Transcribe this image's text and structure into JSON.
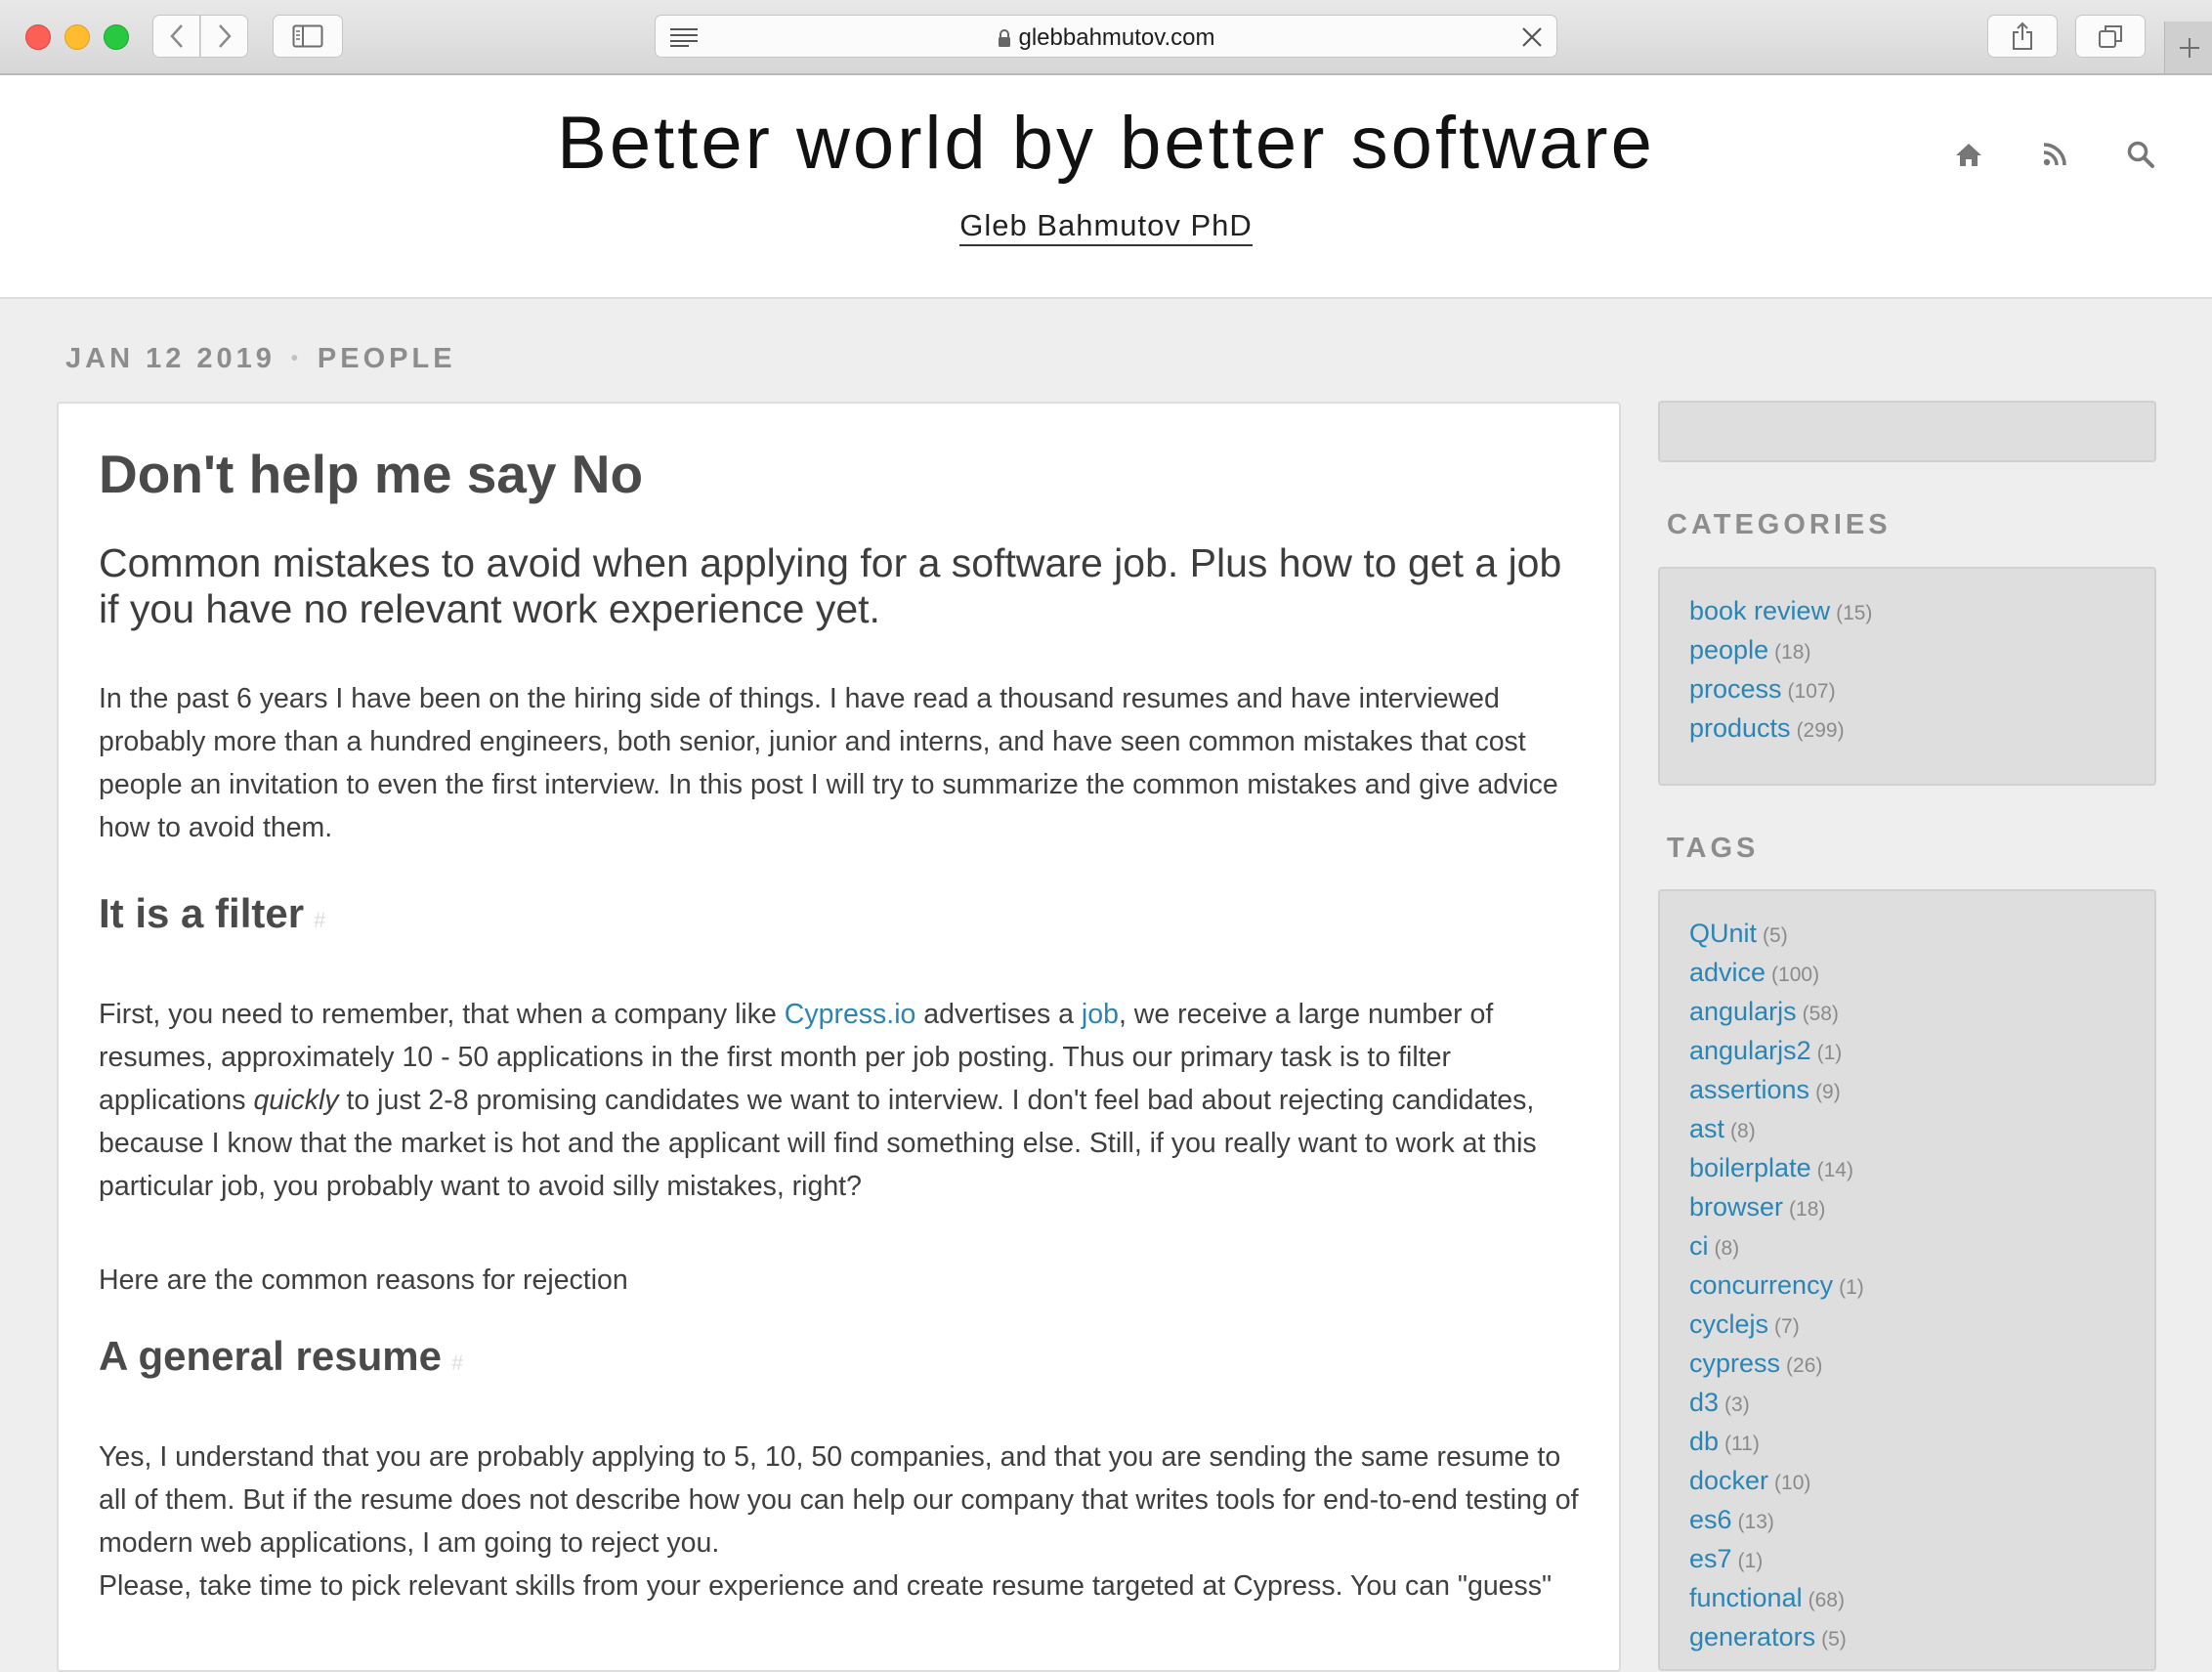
{
  "browser": {
    "url": "glebbahmutov.com",
    "icons": [
      "back-icon",
      "forward-icon",
      "sidebar-icon",
      "reader-icon",
      "lock-icon",
      "close-icon",
      "share-icon",
      "tabs-icon",
      "plus-icon"
    ]
  },
  "header": {
    "title": "Better world by better software",
    "subtitle": "Gleb Bahmutov PhD",
    "icons": [
      "home-icon",
      "rss-icon",
      "search-icon"
    ]
  },
  "meta": {
    "date": "JAN 12 2019",
    "separator": "•",
    "category": "PEOPLE"
  },
  "article": {
    "title": "Don't help me say No",
    "lead": "Common mistakes to avoid when applying for a software job. Plus how to get a job if you have no relevant work experience yet.",
    "intro": "In the past 6 years I have been on the hiring side of things. I have read a thousand resumes and have interviewed probably more than a hundred engineers, both senior, junior and interns, and have seen common mistakes that cost people an invitation to even the first interview. In this post I will try to summarize the common mistakes and give advice how to avoid them.",
    "section1": {
      "heading": "It is a filter",
      "anchor": "#",
      "p1_part1": "First, you need to remember, that when a company like ",
      "p1_link1": "Cypress.io",
      "p1_part2": " advertises a ",
      "p1_link2": "job",
      "p1_part3": ", we receive a large number of resumes, approximately 10 - 50 applications in the first month per job posting. Thus our primary task is to filter applications ",
      "p1_em": "quickly",
      "p1_part4": " to just 2-8 promising candidates we want to interview. I don't feel bad about rejecting candidates, because I know that the market is hot and the applicant will find something else. Still, if you really want to work at this particular job, you probably want to avoid silly mistakes, right?",
      "p2": "Here are the common reasons for rejection"
    },
    "section2": {
      "heading": "A general resume",
      "anchor": "#",
      "p1": "Yes, I understand that you are probably applying to 5, 10, 50 companies, and that you are sending the same resume to all of them. But if the resume does not describe how you can help our company that writes tools for end-to-end testing of modern web applications, I am going to reject you.",
      "p2": "Please, take time to pick relevant skills from your experience and create resume targeted at Cypress. You can \"guess\""
    }
  },
  "sidebar": {
    "categories_heading": "CATEGORIES",
    "categories": [
      {
        "name": "book review",
        "count": "(15)"
      },
      {
        "name": "people",
        "count": "(18)"
      },
      {
        "name": "process",
        "count": "(107)"
      },
      {
        "name": "products",
        "count": "(299)"
      }
    ],
    "tags_heading": "TAGS",
    "tags": [
      {
        "name": "QUnit",
        "count": "(5)"
      },
      {
        "name": "advice",
        "count": "(100)"
      },
      {
        "name": "angularjs",
        "count": "(58)"
      },
      {
        "name": "angularjs2",
        "count": "(1)"
      },
      {
        "name": "assertions",
        "count": "(9)"
      },
      {
        "name": "ast",
        "count": "(8)"
      },
      {
        "name": "boilerplate",
        "count": "(14)"
      },
      {
        "name": "browser",
        "count": "(18)"
      },
      {
        "name": "ci",
        "count": "(8)"
      },
      {
        "name": "concurrency",
        "count": "(1)"
      },
      {
        "name": "cyclejs",
        "count": "(7)"
      },
      {
        "name": "cypress",
        "count": "(26)"
      },
      {
        "name": "d3",
        "count": "(3)"
      },
      {
        "name": "db",
        "count": "(11)"
      },
      {
        "name": "docker",
        "count": "(10)"
      },
      {
        "name": "es6",
        "count": "(13)"
      },
      {
        "name": "es7",
        "count": "(1)"
      },
      {
        "name": "functional",
        "count": "(68)"
      },
      {
        "name": "generators",
        "count": "(5)"
      }
    ]
  },
  "colors": {
    "link": "#2a85b5",
    "page_background": "#eeeeee",
    "sidebar_box": "#dedede"
  }
}
